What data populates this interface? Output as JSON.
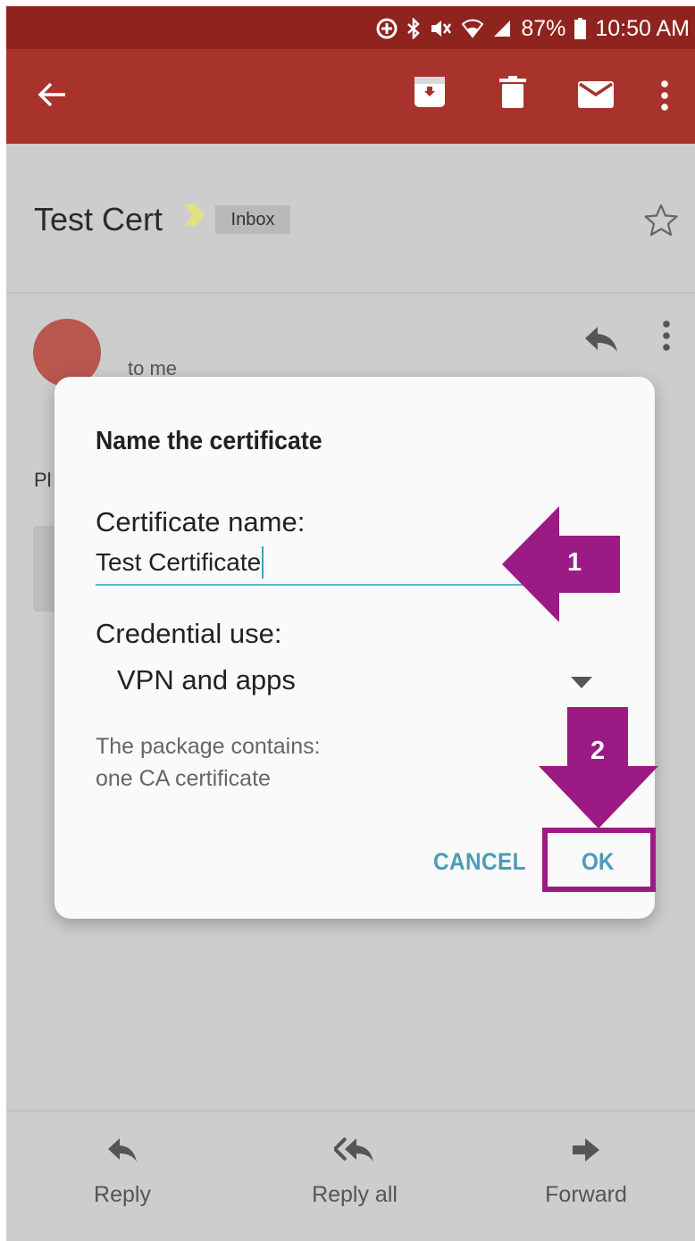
{
  "status": {
    "battery": "87%",
    "time": "10:50 AM"
  },
  "appbar": {
    "icons": [
      "back-arrow-icon",
      "archive-icon",
      "delete-icon",
      "mail-icon",
      "more-vert-icon"
    ]
  },
  "email": {
    "subject": "Test Cert",
    "label": "Inbox",
    "recipient": "to me",
    "body_start": "Pl"
  },
  "dialog": {
    "title": "Name the certificate",
    "name_label": "Certificate name:",
    "name_value": "Test Certificate",
    "use_label": "Credential use:",
    "use_value": "VPN and apps",
    "info_line1": "The package contains:",
    "info_line2": "one CA certificate",
    "cancel": "CANCEL",
    "ok": "OK"
  },
  "annotations": {
    "step1": "1",
    "step2": "2",
    "color": "#9c1a83"
  },
  "bottom": {
    "reply": "Reply",
    "reply_all": "Reply all",
    "forward": "Forward"
  },
  "colors": {
    "appbar": "#a8332c",
    "statusbar": "#8f231d",
    "accent": "#4a9cb8"
  }
}
